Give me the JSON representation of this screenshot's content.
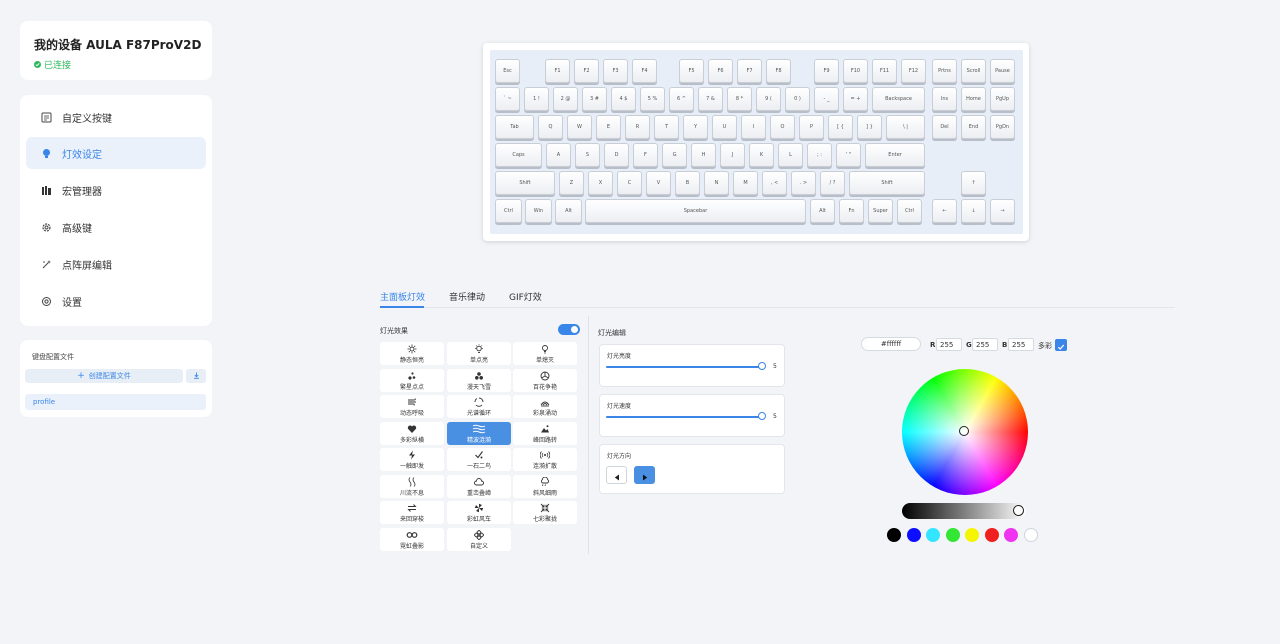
{
  "device": {
    "title": "我的设备 AULA F87ProV2D",
    "status": "已连接"
  },
  "nav": {
    "items": [
      {
        "label": "自定义按键",
        "icon": "keyboard-icon"
      },
      {
        "label": "灯效设定",
        "icon": "lightbulb-icon",
        "active": true
      },
      {
        "label": "宏管理器",
        "icon": "macro-icon"
      },
      {
        "label": "高级键",
        "icon": "gear-icon"
      },
      {
        "label": "点阵屏编辑",
        "icon": "sparkle-icon"
      },
      {
        "label": "设置",
        "icon": "settings-icon"
      }
    ]
  },
  "profiles": {
    "title": "键盘配置文件",
    "create_label": "创建配置文件",
    "create_icon": "plus-icon",
    "import_icon": "import-icon",
    "items": [
      "profile"
    ]
  },
  "keyboard": {
    "rows": [
      [
        "Esc",
        "F1",
        "F2",
        "F3",
        "F4",
        "F5",
        "F6",
        "F7",
        "F8",
        "F9",
        "F10",
        "F11",
        "F12",
        "Prtns",
        "Scroll",
        "Pause"
      ],
      [
        "` ~",
        "1 !",
        "2 @",
        "3 #",
        "4 $",
        "5 %",
        "6 ^",
        "7 &",
        "8 *",
        "9 (",
        "0 )",
        "- _",
        "= +",
        "Backspace",
        "Ins",
        "Home",
        "PgUp"
      ],
      [
        "Tab",
        "Q",
        "W",
        "E",
        "R",
        "T",
        "Y",
        "U",
        "I",
        "O",
        "P",
        "[ {",
        "] }",
        "\\ |",
        "Del",
        "End",
        "PgDn"
      ],
      [
        "Caps",
        "A",
        "S",
        "D",
        "F",
        "G",
        "H",
        "J",
        "K",
        "L",
        "; :",
        "' \"",
        "Enter"
      ],
      [
        "Shift",
        "Z",
        "X",
        "C",
        "V",
        "B",
        "N",
        "M",
        ", <",
        ". >",
        "/ ?",
        "Shift",
        "↑"
      ],
      [
        "Ctrl",
        "Win",
        "Alt",
        "Spacebar",
        "Alt",
        "Fn",
        "Super",
        "Ctrl",
        "←",
        "↓",
        "→"
      ]
    ]
  },
  "tabs": [
    {
      "label": "主面板灯效",
      "active": true
    },
    {
      "label": "音乐律动"
    },
    {
      "label": "GIF灯效"
    }
  ],
  "effects": {
    "title": "灯光效果",
    "enabled": true,
    "items": [
      {
        "label": "静态恒亮",
        "icon": "sun-icon"
      },
      {
        "label": "单点亮",
        "icon": "bulb-on-icon"
      },
      {
        "label": "单熄灭",
        "icon": "bulb-off-icon"
      },
      {
        "label": "繁星点点",
        "icon": "stars-icon"
      },
      {
        "label": "漫天飞雪",
        "icon": "snow-icon"
      },
      {
        "label": "百花争艳",
        "icon": "flower-icon"
      },
      {
        "label": "动态呼吸",
        "icon": "breath-icon"
      },
      {
        "label": "光谱循环",
        "icon": "cycle-icon"
      },
      {
        "label": "彩泉涌动",
        "icon": "fountain-icon"
      },
      {
        "label": "多彩纵横",
        "icon": "heart-icon"
      },
      {
        "label": "精波涟漪",
        "icon": "waves-icon",
        "active": true
      },
      {
        "label": "峰回路转",
        "icon": "mountain-icon"
      },
      {
        "label": "一触即发",
        "icon": "lightning-icon"
      },
      {
        "label": "一石二鸟",
        "icon": "check-icon"
      },
      {
        "label": "连漪扩散",
        "icon": "ripple-icon"
      },
      {
        "label": "川流不息",
        "icon": "stream-icon"
      },
      {
        "label": "重峦叠嶂",
        "icon": "cloud-icon"
      },
      {
        "label": "斜风细雨",
        "icon": "rain-icon"
      },
      {
        "label": "来回穿梭",
        "icon": "swap-icon"
      },
      {
        "label": "彩虹风车",
        "icon": "windmill-icon"
      },
      {
        "label": "七彩聚拢",
        "icon": "gather-icon"
      },
      {
        "label": "霓虹叠影",
        "icon": "infinity-icon"
      },
      {
        "label": "自定义",
        "icon": "custom-icon"
      }
    ]
  },
  "light_edit": {
    "title": "灯光编辑",
    "brightness": {
      "label": "灯光亮度",
      "value": "5",
      "level": 1.0
    },
    "speed": {
      "label": "灯光速度",
      "value": "5",
      "level": 1.0
    },
    "direction": {
      "label": "灯光方向",
      "left_icon": "arrow-left-icon",
      "right_icon": "arrow-right-icon"
    }
  },
  "color": {
    "hex": "#ffffff",
    "r_label": "R",
    "r": "255",
    "g_label": "G",
    "g": "255",
    "b_label": "B",
    "b": "255",
    "multicolor_label": "多彩",
    "multicolor": true,
    "swatches": [
      "#000000",
      "#0d0dff",
      "#33e6ff",
      "#33e633",
      "#f5f500",
      "#f02020",
      "#f033f0",
      "#ffffff"
    ]
  }
}
